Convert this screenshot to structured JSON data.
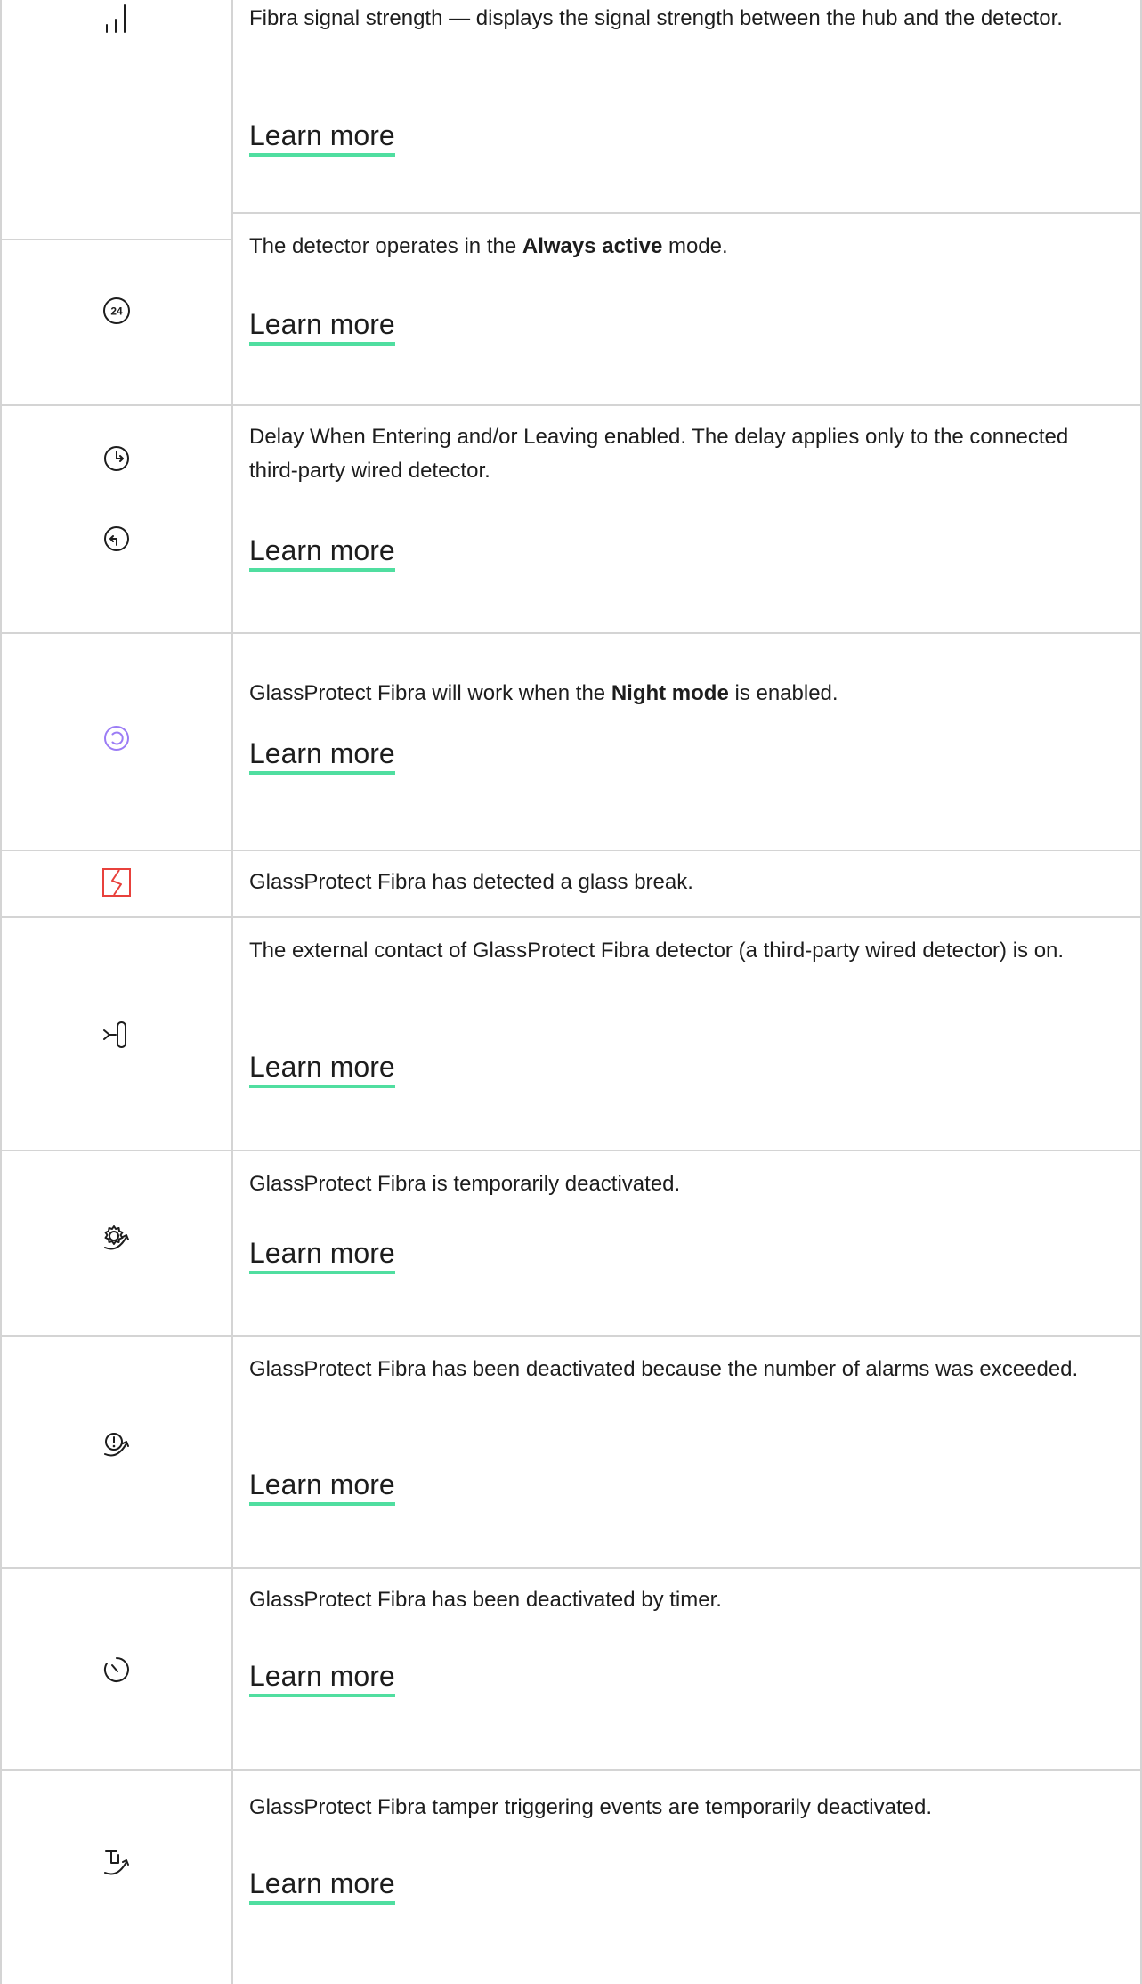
{
  "rows": [
    {
      "icon": "signal-strength-icon",
      "text": "Fibra signal strength — displays the signal strength between the hub and the detector.",
      "link": "Learn more"
    },
    {
      "icon": "always-active-24-icon",
      "text_before": "The detector operates in the ",
      "text_bold": "Always active",
      "text_after": " mode.",
      "link": "Learn more"
    },
    {
      "icon": "delay-entering-icon",
      "icon_secondary": "delay-leaving-icon",
      "text": "Delay When Entering and/or Leaving enabled. The delay applies only to the connected third-party wired detector.",
      "link": "Learn more"
    },
    {
      "icon": "night-mode-icon",
      "text_before": "GlassProtect Fibra will work when the ",
      "text_bold": "Night mode",
      "text_after": " is enabled.",
      "link": "Learn more",
      "icon_color": "#9b7cf5"
    },
    {
      "icon": "glass-break-icon",
      "text": "GlassProtect Fibra has detected a glass break.",
      "icon_color": "#e8413c"
    },
    {
      "icon": "external-contact-icon",
      "text": "The external contact of GlassProtect Fibra detector (a third-party wired detector) is on.",
      "link": "Learn more"
    },
    {
      "icon": "temporarily-deactivated-icon",
      "text": "GlassProtect Fibra is temporarily deactivated.",
      "link": "Learn more"
    },
    {
      "icon": "alarms-exceeded-deactivated-icon",
      "text": "GlassProtect Fibra has been deactivated because the number of alarms was exceeded.",
      "link": "Learn more"
    },
    {
      "icon": "timer-deactivated-icon",
      "text": "GlassProtect Fibra has been deactivated by timer.",
      "link": "Learn more"
    },
    {
      "icon": "tamper-deactivated-icon",
      "text": "GlassProtect Fibra tamper triggering events are temporarily deactivated.",
      "link": "Learn more"
    }
  ],
  "colors": {
    "border": "#d4d4d4",
    "link_underline": "#50dea0",
    "text": "#1d1d1d"
  }
}
